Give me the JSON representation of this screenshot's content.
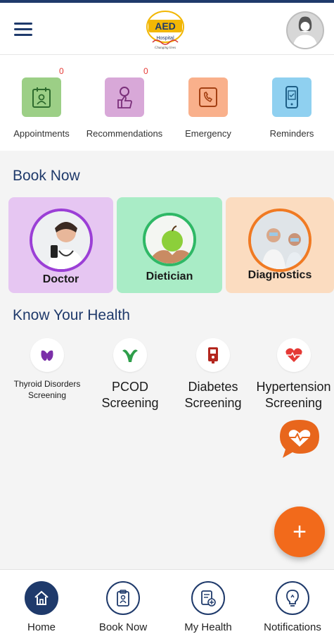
{
  "header": {
    "menu_icon": "hamburger-menu-icon",
    "logo_text": "AED",
    "logo_subtext": "Hospital",
    "logo_tagline": "Changing lives",
    "avatar_icon": "user-avatar-icon"
  },
  "quick_actions": [
    {
      "label": "Appointments",
      "icon": "calendar-user-icon",
      "color": "#9ccf86",
      "badge": "0"
    },
    {
      "label": "Recommendations",
      "icon": "thumbs-up-user-icon",
      "color": "#d8a8d8",
      "badge": "0"
    },
    {
      "label": "Emergency",
      "icon": "phone-emergency-icon",
      "color": "#f9b08b"
    },
    {
      "label": "Reminders",
      "icon": "mobile-reminder-icon",
      "color": "#8fd0f0"
    }
  ],
  "book_now": {
    "title": "Book Now",
    "cards": [
      {
        "label": "Doctor",
        "bg": "#e6c6f2",
        "ring": "#9b3fd6"
      },
      {
        "label": "Dietician",
        "bg": "#a9ecc6",
        "ring": "#2fb866"
      },
      {
        "label": "Diagnostics",
        "bg": "#fbdcc0",
        "ring": "#f07a23"
      }
    ]
  },
  "know_health": {
    "title": "Know Your Health",
    "items": [
      {
        "line1": "Thyroid Disorders",
        "line2": "Screening",
        "icon": "thyroid-icon",
        "size": "small"
      },
      {
        "line1": "PCOD",
        "line2": "Screening",
        "icon": "uterus-icon",
        "size": "large"
      },
      {
        "line1": "Diabetes",
        "line2": "Screening",
        "icon": "glucose-meter-icon",
        "size": "large"
      },
      {
        "line1": "Hypertension",
        "line2": "Screening",
        "icon": "heart-pulse-icon",
        "size": "large"
      }
    ]
  },
  "chat_icon": "heart-chat-bubble-icon",
  "fab_label": "+",
  "bottom_nav": [
    {
      "label": "Home",
      "icon": "home-icon",
      "active": true
    },
    {
      "label": "Book Now",
      "icon": "clipboard-user-icon",
      "active": false
    },
    {
      "label": "My Health",
      "icon": "health-record-icon",
      "active": false
    },
    {
      "label": "Notifications",
      "icon": "lightbulb-icon",
      "active": false
    }
  ],
  "colors": {
    "navy": "#1f3a6b",
    "orange": "#f26a1b",
    "badge_red": "#e53935"
  }
}
